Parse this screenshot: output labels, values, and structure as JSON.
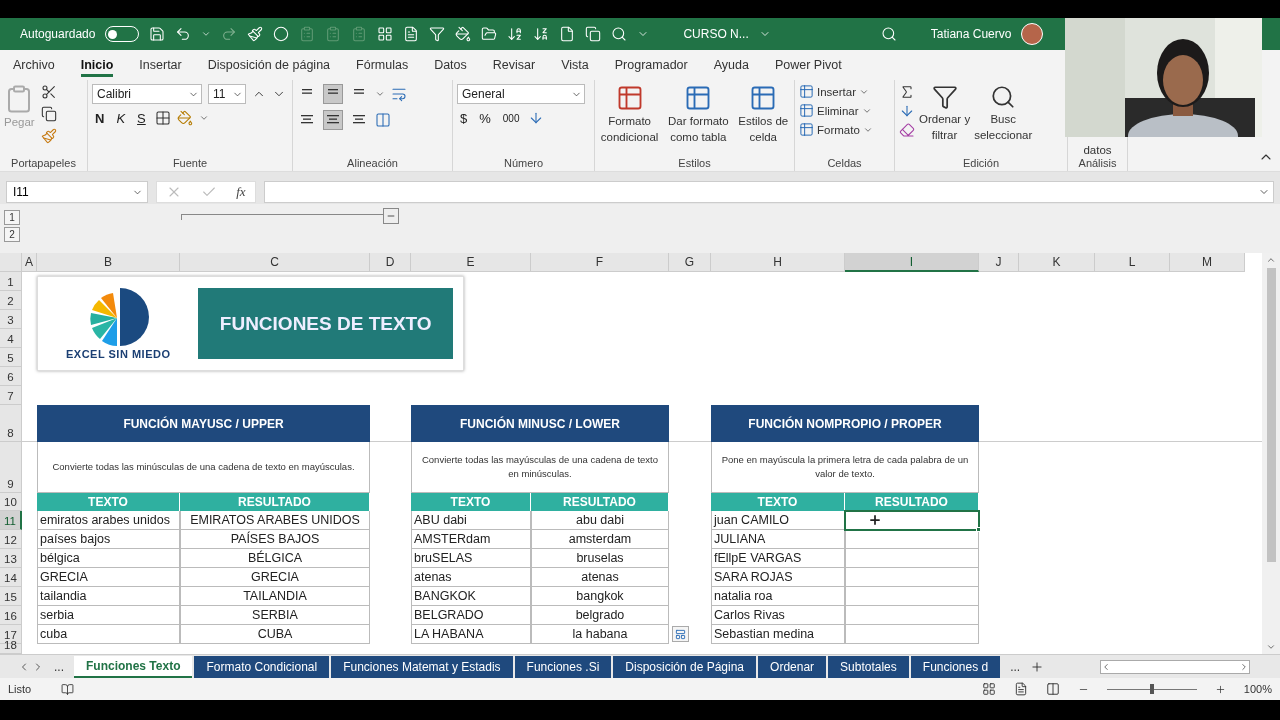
{
  "title_bar": {
    "autosave_label": "Autoguardado",
    "autosave_on": false,
    "document": "CURSO N...",
    "user": "Tatiana Cuervo"
  },
  "ribbon_tabs": [
    {
      "label": "Archivo",
      "selected": false
    },
    {
      "label": "Inicio",
      "selected": true
    },
    {
      "label": "Insertar",
      "selected": false
    },
    {
      "label": "Disposición de página",
      "selected": false
    },
    {
      "label": "Fórmulas",
      "selected": false
    },
    {
      "label": "Datos",
      "selected": false
    },
    {
      "label": "Revisar",
      "selected": false
    },
    {
      "label": "Vista",
      "selected": false
    },
    {
      "label": "Programador",
      "selected": false
    },
    {
      "label": "Ayuda",
      "selected": false
    },
    {
      "label": "Power Pivot",
      "selected": false
    }
  ],
  "ribbon": {
    "clipboard": {
      "paste": "Pegar",
      "label": "Portapapeles"
    },
    "font": {
      "name": "Calibri",
      "size": "11",
      "bold": "N",
      "italic": "K",
      "underline": "S",
      "label": "Fuente"
    },
    "alignment": {
      "vertical": [
        {
          "selected": false
        },
        {
          "selected": true
        },
        {
          "selected": false
        }
      ],
      "horizontal": [
        {
          "selected": false
        },
        {
          "selected": true
        },
        {
          "selected": false
        }
      ],
      "label": "Alineación"
    },
    "number": {
      "format": "General",
      "currency": "$",
      "percent": "%",
      "thousands": "000",
      "label": "Número"
    },
    "styles": {
      "buttons": [
        {
          "lines": [
            "Formato",
            "condicional"
          ]
        },
        {
          "lines": [
            "Dar formato",
            "como tabla"
          ]
        },
        {
          "lines": [
            "Estilos de",
            "celda"
          ]
        }
      ],
      "label": "Estilos"
    },
    "cells": {
      "buttons": [
        "Insertar",
        "Eliminar",
        "Formato"
      ],
      "label": "Celdas"
    },
    "editing": {
      "buttons": [
        {
          "lines": [
            "Ordenar y",
            "filtrar"
          ]
        },
        {
          "lines": [
            "Busc",
            "seleccionar"
          ]
        }
      ],
      "label": "Edición"
    },
    "analysis": {
      "text": "datos",
      "label": "Análisis"
    }
  },
  "formula_bar": {
    "name_box": "I11",
    "function_label": "fx"
  },
  "outline_levels": [
    "1",
    "2"
  ],
  "columns": [
    {
      "label": "A",
      "selected": false
    },
    {
      "label": "B",
      "selected": false
    },
    {
      "label": "C",
      "selected": false
    },
    {
      "label": "D",
      "selected": false
    },
    {
      "label": "E",
      "selected": false
    },
    {
      "label": "F",
      "selected": false
    },
    {
      "label": "G",
      "selected": false
    },
    {
      "label": "H",
      "selected": false
    },
    {
      "label": "I",
      "selected": true
    },
    {
      "label": "J",
      "selected": false
    },
    {
      "label": "K",
      "selected": false
    },
    {
      "label": "L",
      "selected": false
    },
    {
      "label": "M",
      "selected": false
    }
  ],
  "rows": [
    {
      "label": "1",
      "selected": false
    },
    {
      "label": "2",
      "selected": false
    },
    {
      "label": "3",
      "selected": false
    },
    {
      "label": "4",
      "selected": false
    },
    {
      "label": "5",
      "selected": false
    },
    {
      "label": "6",
      "selected": false
    },
    {
      "label": "7",
      "selected": false
    },
    {
      "label": "8",
      "selected": false
    },
    {
      "label": "9",
      "selected": false
    },
    {
      "label": "10",
      "selected": false
    },
    {
      "label": "11",
      "selected": true
    },
    {
      "label": "12",
      "selected": false
    },
    {
      "label": "13",
      "selected": false
    },
    {
      "label": "14",
      "selected": false
    },
    {
      "label": "15",
      "selected": false
    },
    {
      "label": "16",
      "selected": false
    },
    {
      "label": "17",
      "selected": false
    },
    {
      "label": "18",
      "selected": false
    }
  ],
  "banner": {
    "logo_text": "EXCEL SIN MIEDO",
    "title": "FUNCIONES DE TEXTO"
  },
  "tables": [
    {
      "title": "FUNCIÓN MAYUSC / UPPER",
      "description": "Convierte todas las minúsculas de una cadena de texto en mayúsculas.",
      "headers": [
        "TEXTO",
        "RESULTADO"
      ],
      "rows": [
        {
          "text": "emiratos arabes unidos",
          "result": "EMIRATOS ARABES UNIDOS",
          "selected": false
        },
        {
          "text": "países bajos",
          "result": "PAÍSES BAJOS",
          "selected": false
        },
        {
          "text": "bélgica",
          "result": "BÉLGICA",
          "selected": false
        },
        {
          "text": "GRECIA",
          "result": "GRECIA",
          "selected": false
        },
        {
          "text": "tailandia",
          "result": "TAILANDIA",
          "selected": false
        },
        {
          "text": "serbia",
          "result": "SERBIA",
          "selected": false
        },
        {
          "text": "cuba",
          "result": "CUBA",
          "selected": false
        }
      ]
    },
    {
      "title": "FUNCIÓN MINUSC / LOWER",
      "description": "Convierte todas las mayúsculas de una cadena de texto en minúsculas.",
      "headers": [
        "TEXTO",
        "RESULTADO"
      ],
      "rows": [
        {
          "text": "ABU dabi",
          "result": "abu dabi",
          "selected": false
        },
        {
          "text": "AMSTERdam",
          "result": "amsterdam",
          "selected": false
        },
        {
          "text": "bruSELAS",
          "result": "bruselas",
          "selected": false
        },
        {
          "text": "atenas",
          "result": "atenas",
          "selected": false
        },
        {
          "text": "BANGKOK",
          "result": "bangkok",
          "selected": false
        },
        {
          "text": "BELGRADO",
          "result": "belgrado",
          "selected": false
        },
        {
          "text": "LA HABANA",
          "result": "la habana",
          "selected": false
        }
      ]
    },
    {
      "title": "FUNCIÓN NOMPROPIO / PROPER",
      "description": "Pone en mayúscula la primera letra de cada palabra de un valor de texto.",
      "headers": [
        "TEXTO",
        "RESULTADO"
      ],
      "rows": [
        {
          "text": "juan CAMILO",
          "selected": true
        },
        {
          "text": "JULIANA",
          "selected": false
        },
        {
          "text": "fEllpE VARGAS",
          "selected": false
        },
        {
          "text": "SARA ROJAS",
          "selected": false
        },
        {
          "text": "natalia roa",
          "selected": false
        },
        {
          "text": "Carlos Rivas",
          "selected": false
        },
        {
          "text": "Sebastian medina",
          "selected": false
        }
      ]
    }
  ],
  "sheet_tabs": [
    {
      "label": "Funciones Texto",
      "selected": true
    },
    {
      "label": "Formato Condicional",
      "selected": false
    },
    {
      "label": "Funciones Matemat y Estadis",
      "selected": false
    },
    {
      "label": "Funciones .Si",
      "selected": false
    },
    {
      "label": "Disposición de Página",
      "selected": false
    },
    {
      "label": "Ordenar",
      "selected": false
    },
    {
      "label": "Subtotales",
      "selected": false
    },
    {
      "label": "Funciones d",
      "selected": false
    }
  ],
  "tab_overflow": [
    "...",
    "..."
  ],
  "status_bar": {
    "text": "Listo",
    "zoom": "100%",
    "zoom_slider": {
      "level": 0.5
    }
  }
}
